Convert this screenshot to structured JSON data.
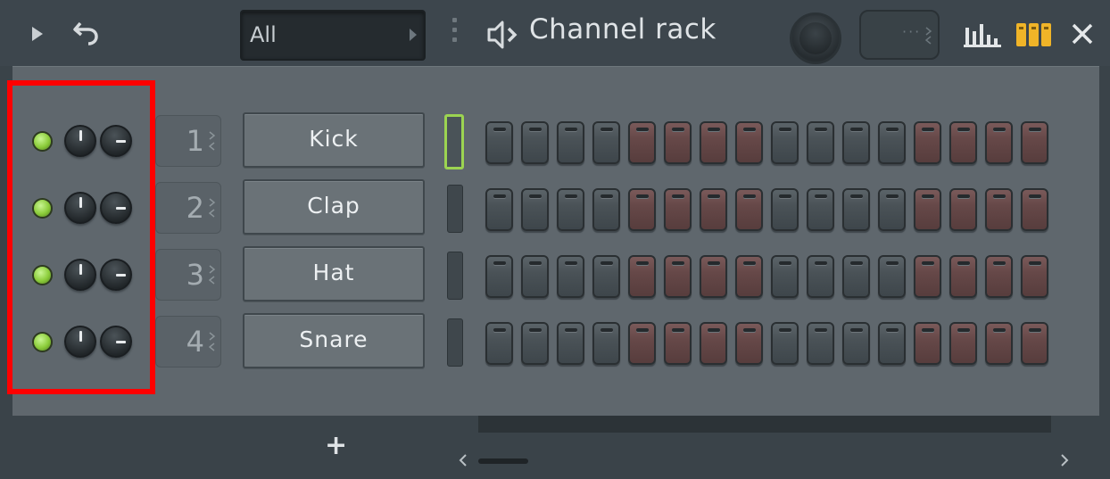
{
  "title_bar": {
    "filter_value": "All",
    "title": "Channel rack",
    "swing_dots": "···",
    "icons": {
      "play": "play-arrow-icon",
      "undo": "undo-icon",
      "speaker": "speaker-icon",
      "graph": "graph-editor-icon",
      "steps": "step-sequencer-icon",
      "close": "close-icon"
    }
  },
  "channels": [
    {
      "number": "1",
      "name": "Kick",
      "selected": true,
      "steps": [
        0,
        0,
        0,
        0,
        1,
        1,
        1,
        1,
        0,
        0,
        0,
        0,
        1,
        1,
        1,
        1
      ]
    },
    {
      "number": "2",
      "name": "Clap",
      "selected": false,
      "steps": [
        0,
        0,
        0,
        0,
        1,
        1,
        1,
        1,
        0,
        0,
        0,
        0,
        1,
        1,
        1,
        1
      ]
    },
    {
      "number": "3",
      "name": "Hat",
      "selected": false,
      "steps": [
        0,
        0,
        0,
        0,
        1,
        1,
        1,
        1,
        0,
        0,
        0,
        0,
        1,
        1,
        1,
        1
      ]
    },
    {
      "number": "4",
      "name": "Snare",
      "selected": false,
      "steps": [
        0,
        0,
        0,
        0,
        1,
        1,
        1,
        1,
        0,
        0,
        0,
        0,
        1,
        1,
        1,
        1
      ]
    }
  ],
  "bottom": {
    "add_label": "+"
  },
  "colors": {
    "led_on": "#8bcc3a",
    "step_group_a": "#4a5257",
    "step_group_b": "#664848",
    "highlight": "#ff0000",
    "selected_outline": "#9cd451"
  }
}
